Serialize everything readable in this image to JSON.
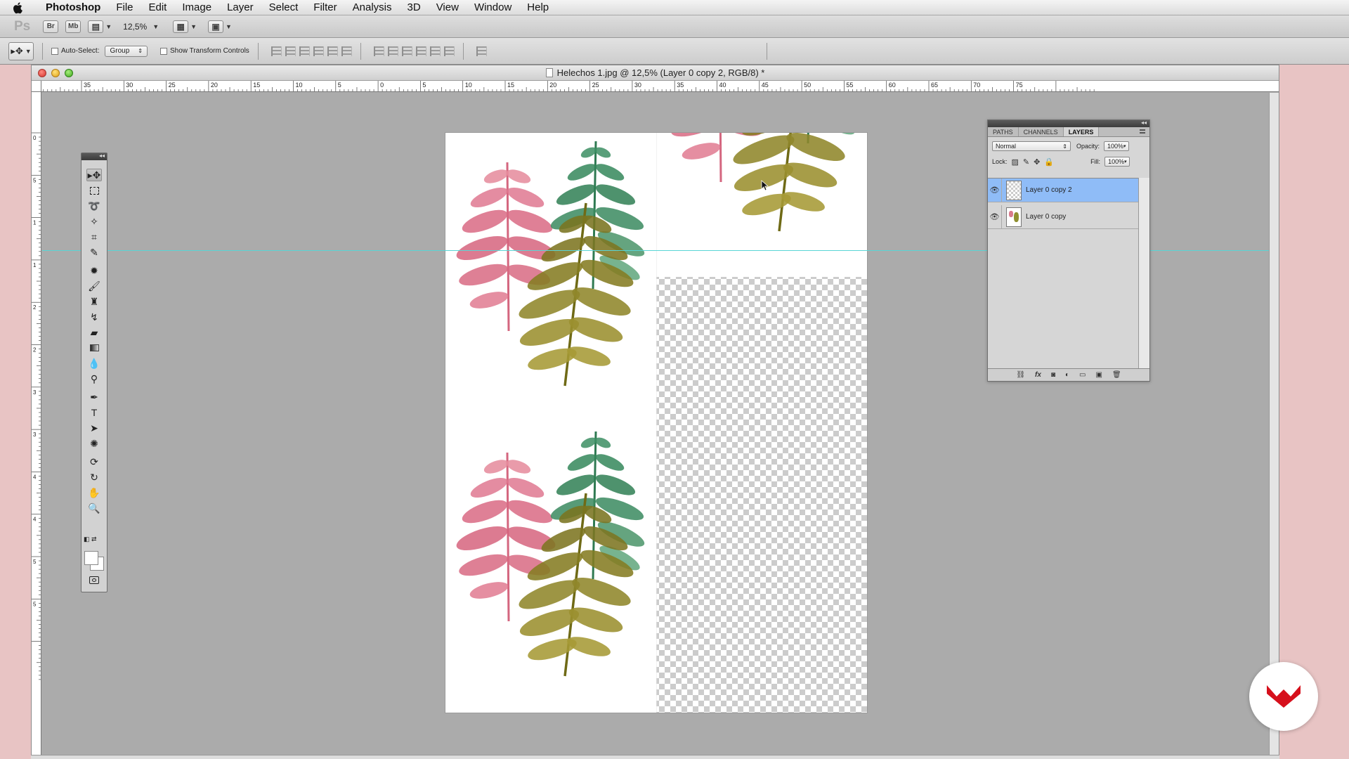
{
  "menubar": {
    "app": "Photoshop",
    "items": [
      "File",
      "Edit",
      "Image",
      "Layer",
      "Select",
      "Filter",
      "Analysis",
      "3D",
      "View",
      "Window",
      "Help"
    ]
  },
  "appbar": {
    "logo": "Ps",
    "bridge": "Br",
    "minibridge": "Mb",
    "zoom": "12,5%"
  },
  "options": {
    "auto_select_label": "Auto-Select:",
    "auto_select_value": "Group",
    "show_transform_label": "Show Transform Controls"
  },
  "document": {
    "title": "Helechos 1.jpg @ 12,5% (Layer 0 copy 2, RGB/8) *",
    "hruler_labels": [
      "35",
      "30",
      "25",
      "20",
      "15",
      "10",
      "5",
      "0",
      "5",
      "10",
      "15",
      "20",
      "25",
      "30",
      "35",
      "40",
      "45",
      "50",
      "55",
      "60",
      "65",
      "70",
      "75"
    ],
    "vruler_labels": [
      "0",
      "5",
      "1 0",
      "1 5",
      "2 0",
      "2 5",
      "3 0",
      "3 5",
      "4 0",
      "4 5",
      "5 0",
      "5 5"
    ]
  },
  "layers_panel": {
    "tabs": [
      "PATHS",
      "CHANNELS",
      "LAYERS"
    ],
    "active_tab": "LAYERS",
    "blend_mode": "Normal",
    "opacity_label": "Opacity:",
    "opacity": "100%",
    "lock_label": "Lock:",
    "fill_label": "Fill:",
    "fill": "100%",
    "layers": [
      {
        "name": "Layer 0 copy 2",
        "selected": true
      },
      {
        "name": "Layer 0 copy",
        "selected": false
      }
    ]
  },
  "colors": {
    "selection": "#8fbcf7",
    "guide": "#58d5d5",
    "workspace": "#ababab",
    "desktop": "#e8c4c4",
    "watermark": "#d6101c"
  }
}
